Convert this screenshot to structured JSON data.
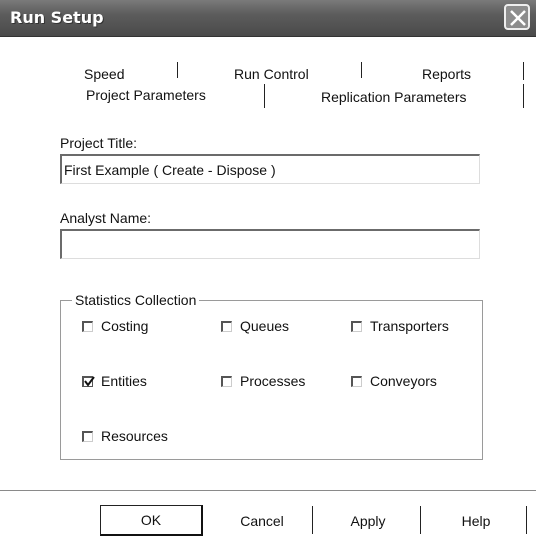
{
  "window": {
    "title": "Run Setup",
    "close_label": "X"
  },
  "tabs": {
    "row1": [
      "Speed",
      "Run Control",
      "Reports"
    ],
    "row2": [
      "Project Parameters",
      "Replication Parameters"
    ]
  },
  "project_title": {
    "label": "Project Title:",
    "value": "First Example ( Create - Dispose )"
  },
  "analyst_name": {
    "label": "Analyst Name:",
    "value": ""
  },
  "statistics": {
    "legend": "Statistics Collection",
    "items": [
      {
        "label": "Costing",
        "checked": false
      },
      {
        "label": "Queues",
        "checked": false
      },
      {
        "label": "Transporters",
        "checked": false
      },
      {
        "label": "Entities",
        "checked": true
      },
      {
        "label": "Processes",
        "checked": false
      },
      {
        "label": "Conveyors",
        "checked": false
      },
      {
        "label": "Resources",
        "checked": false
      }
    ]
  },
  "buttons": {
    "ok": "OK",
    "cancel": "Cancel",
    "apply": "Apply",
    "help": "Help"
  }
}
